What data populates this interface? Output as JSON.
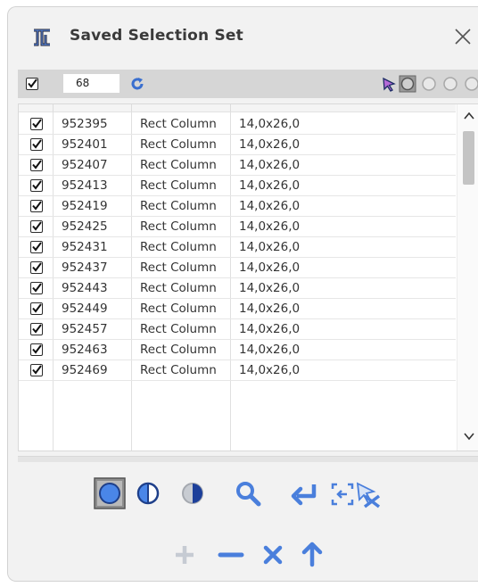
{
  "window": {
    "title": "Saved Selection Set"
  },
  "toolbar": {
    "count": "68"
  },
  "rows": [
    {
      "id": "952395",
      "type": "Rect Column",
      "size": "14,0x26,0"
    },
    {
      "id": "952401",
      "type": "Rect Column",
      "size": "14,0x26,0"
    },
    {
      "id": "952407",
      "type": "Rect Column",
      "size": "14,0x26,0"
    },
    {
      "id": "952413",
      "type": "Rect Column",
      "size": "14,0x26,0"
    },
    {
      "id": "952419",
      "type": "Rect Column",
      "size": "14,0x26,0"
    },
    {
      "id": "952425",
      "type": "Rect Column",
      "size": "14,0x26,0"
    },
    {
      "id": "952431",
      "type": "Rect Column",
      "size": "14,0x26,0"
    },
    {
      "id": "952437",
      "type": "Rect Column",
      "size": "14,0x26,0"
    },
    {
      "id": "952443",
      "type": "Rect Column",
      "size": "14,0x26,0"
    },
    {
      "id": "952449",
      "type": "Rect Column",
      "size": "14,0x26,0"
    },
    {
      "id": "952457",
      "type": "Rect Column",
      "size": "14,0x26,0"
    },
    {
      "id": "952463",
      "type": "Rect Column",
      "size": "14,0x26,0"
    },
    {
      "id": "952469",
      "type": "Rect Column",
      "size": "14,0x26,0"
    }
  ],
  "icons": {
    "logo": "tekla-logo-icon",
    "close": "close-icon",
    "refresh": "refresh-icon",
    "select": "pointer-arrow-icon",
    "zoom": "magnifier-icon",
    "enter": "enter-arrow-icon",
    "add": "plus-icon",
    "remove": "minus-icon",
    "delete": "x-icon",
    "up": "arrow-up-icon"
  },
  "colors": {
    "accent": "#4a7fdc",
    "accent_dark": "#1e4fa8",
    "muted": "#c6cbd3"
  }
}
